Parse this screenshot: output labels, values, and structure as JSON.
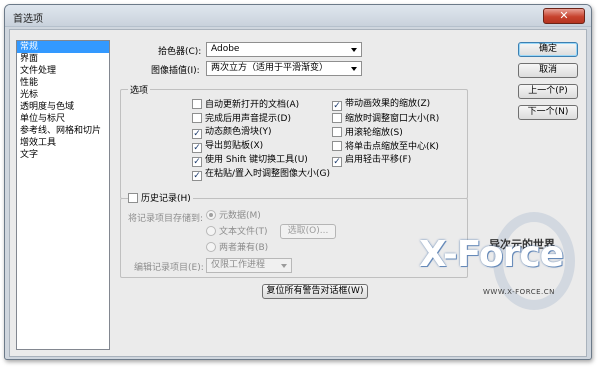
{
  "window": {
    "title": "首选项",
    "close_glyph": "✕"
  },
  "sidebar": {
    "items": [
      {
        "label": "常规",
        "selected": true
      },
      {
        "label": "界面"
      },
      {
        "label": "文件处理"
      },
      {
        "label": "性能"
      },
      {
        "label": "光标"
      },
      {
        "label": "透明度与色域"
      },
      {
        "label": "单位与标尺"
      },
      {
        "label": "参考线、网格和切片"
      },
      {
        "label": "增效工具"
      },
      {
        "label": "文字"
      }
    ]
  },
  "top": {
    "color_picker_label": "拾色器(C):",
    "color_picker_value": "Adobe",
    "interpolation_label": "图像插值(I):",
    "interpolation_value": "两次立方（适用于平滑渐变）"
  },
  "options": {
    "title": "选项",
    "left": [
      {
        "label": "自动更新打开的文档(A)",
        "checked": false
      },
      {
        "label": "完成后用声音提示(D)",
        "checked": false
      },
      {
        "label": "动态颜色滑块(Y)",
        "checked": true
      },
      {
        "label": "导出剪贴板(X)",
        "checked": true
      },
      {
        "label": "使用 Shift 键切换工具(U)",
        "checked": true
      },
      {
        "label": "在粘贴/置入时调整图像大小(G)",
        "checked": true
      }
    ],
    "right": [
      {
        "label": "带动画效果的缩放(Z)",
        "checked": true
      },
      {
        "label": "缩放时调整窗口大小(R)",
        "checked": false
      },
      {
        "label": "用滚轮缩放(S)",
        "checked": false
      },
      {
        "label": "将单击点缩放至中心(K)",
        "checked": false
      },
      {
        "label": "启用轻击平移(F)",
        "checked": true
      }
    ],
    "check_glyph": "✓"
  },
  "history": {
    "checkbox_label": "历史记录(H)",
    "save_to_label": "将记录项目存储到:",
    "radio_metadata": "元数据(M)",
    "radio_textfile": "文本文件(T)",
    "choose_button": "选取(O)...",
    "radio_both": "两者兼有(B)",
    "edit_log_label": "编辑记录项目(E):",
    "edit_log_value": "仅限工作进程"
  },
  "reset_button": "复位所有警告对话框(W)",
  "buttons": {
    "ok": "确定",
    "cancel": "取消",
    "prev": "上一个(P)",
    "next": "下一个(N)"
  },
  "watermark": {
    "logo": "X-Force",
    "cn": "异次元的世界",
    "url": "WWW.X-FORCE.CN"
  }
}
